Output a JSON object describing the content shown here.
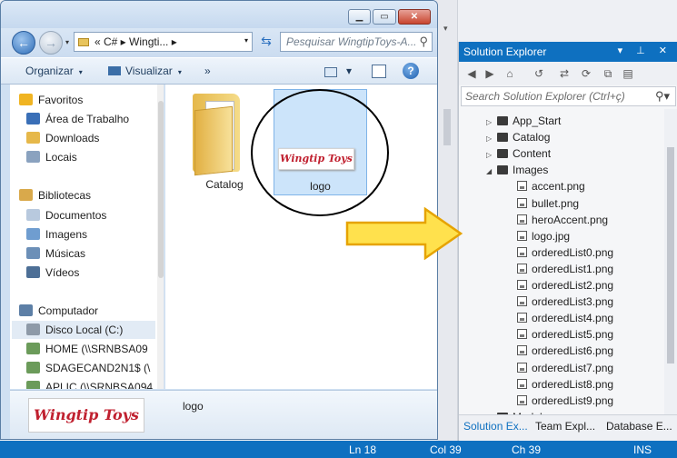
{
  "vs": {
    "statusbar": {
      "line": "Ln 18",
      "col": "Col 39",
      "ch": "Ch 39",
      "ins": "INS"
    }
  },
  "solution_explorer": {
    "title": "Solution Explorer",
    "controls": "▾ ⊥ ✕",
    "search_placeholder": "Search Solution Explorer (Ctrl+ç)",
    "tree": [
      {
        "label": "App_Start",
        "type": "folder",
        "expanded": false
      },
      {
        "label": "Catalog",
        "type": "folder",
        "expanded": false
      },
      {
        "label": "Content",
        "type": "folder",
        "expanded": false
      },
      {
        "label": "Images",
        "type": "folder",
        "expanded": true
      },
      {
        "label": "accent.png",
        "type": "image"
      },
      {
        "label": "bullet.png",
        "type": "image"
      },
      {
        "label": "heroAccent.png",
        "type": "image"
      },
      {
        "label": "logo.jpg",
        "type": "image"
      },
      {
        "label": "orderedList0.png",
        "type": "image"
      },
      {
        "label": "orderedList1.png",
        "type": "image"
      },
      {
        "label": "orderedList2.png",
        "type": "image"
      },
      {
        "label": "orderedList3.png",
        "type": "image"
      },
      {
        "label": "orderedList4.png",
        "type": "image"
      },
      {
        "label": "orderedList5.png",
        "type": "image"
      },
      {
        "label": "orderedList6.png",
        "type": "image"
      },
      {
        "label": "orderedList7.png",
        "type": "image"
      },
      {
        "label": "orderedList8.png",
        "type": "image"
      },
      {
        "label": "orderedList9.png",
        "type": "image"
      },
      {
        "label": "Models",
        "type": "folder",
        "expanded": false
      }
    ],
    "tabs": [
      "Solution Ex...",
      "Team Expl...",
      "Database E..."
    ]
  },
  "explorer": {
    "address_path": "« C# ▸ Wingti... ▸",
    "search_placeholder": "Pesquisar WingtipToys-A...",
    "commands": {
      "organize": "Organizar",
      "view": "Visualizar",
      "more": "»"
    },
    "nav": [
      {
        "label": "Favoritos",
        "icon": "star-icon",
        "color": "#f0b422",
        "group": true
      },
      {
        "label": "Área de Trabalho",
        "icon": "desktop-icon",
        "color": "#3a6fb7"
      },
      {
        "label": "Downloads",
        "icon": "downloads-icon",
        "color": "#e6b84a"
      },
      {
        "label": "Locais",
        "icon": "places-icon",
        "color": "#8aa2bf"
      },
      {
        "label": "Bibliotecas",
        "icon": "library-icon",
        "color": "#d9a94b",
        "group": true
      },
      {
        "label": "Documentos",
        "icon": "documents-icon",
        "color": "#b8c9de"
      },
      {
        "label": "Imagens",
        "icon": "pictures-icon",
        "color": "#6f9dd0"
      },
      {
        "label": "Músicas",
        "icon": "music-icon",
        "color": "#6c8fb7"
      },
      {
        "label": "Vídeos",
        "icon": "videos-icon",
        "color": "#4d6f96"
      },
      {
        "label": "Computador",
        "icon": "computer-icon",
        "color": "#5d7fa6",
        "group": true
      },
      {
        "label": "Disco Local (C:)",
        "icon": "disk-icon",
        "color": "#8e9aa8",
        "selected": true
      },
      {
        "label": "HOME (\\\\SRNBSA09",
        "icon": "network-drive-icon",
        "color": "#6b9b5a"
      },
      {
        "label": "SDAGECAND2N1$ (\\",
        "icon": "network-drive-icon",
        "color": "#6b9b5a"
      },
      {
        "label": "APLIC (\\\\SRNBSA094",
        "icon": "network-drive-icon",
        "color": "#6b9b5a"
      }
    ],
    "items": [
      {
        "label": "Catalog"
      },
      {
        "label": "logo",
        "logo_text": "Wingtip Toys"
      }
    ],
    "details": {
      "logo_text": "Wingtip Toys",
      "name": "logo"
    }
  }
}
